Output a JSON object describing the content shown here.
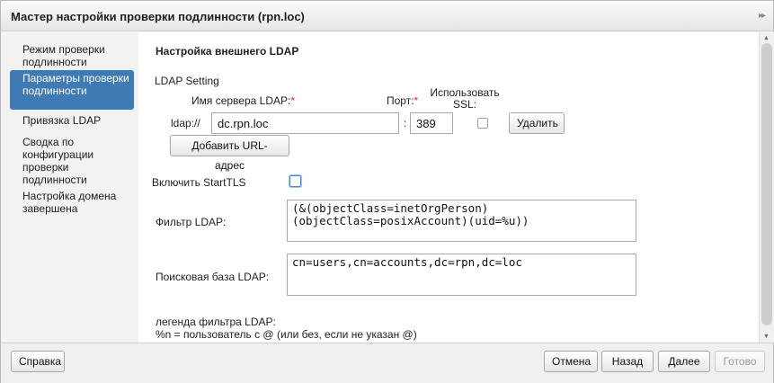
{
  "window": {
    "title": "Мастер настройки проверки подлинности (rpn.loc)",
    "collapse_glyph": "▸▸"
  },
  "sidebar": {
    "items": [
      {
        "label": "Режим проверки подлинности",
        "active": false
      },
      {
        "label": "Параметры проверки подлинности",
        "active": true
      },
      {
        "label": "Привязка LDAP",
        "active": false
      },
      {
        "label": "Сводка по конфигурации проверки подлинности",
        "active": false
      },
      {
        "label": "Настройка домена завершена",
        "active": false
      }
    ]
  },
  "main": {
    "section_title": "Настройка внешнего LDAP",
    "ldap_setting_label": "LDAP Setting",
    "server_name_label": "Имя сервера LDAP:",
    "port_label": "Порт:",
    "required_mark": "*",
    "use_ssl_label": "Использовать SSL:",
    "url_prefix": "ldap://",
    "server_value": "dc.rpn.loc",
    "colon": ":",
    "port_value": "389",
    "ssl_checked": false,
    "delete_button": "Удалить",
    "add_url_button": "Добавить URL-адрес",
    "starttls_label": "Включить StartTLS",
    "starttls_checked": false,
    "filter_label": "Фильтр LDAP:",
    "filter_value": "(&(objectClass=inetOrgPerson)\n(objectClass=posixAccount)(uid=%u))",
    "search_base_label": "Поисковая база LDAP:",
    "search_base_value": "cn=users,cn=accounts,dc=rpn,dc=loc",
    "legend_title": "легенда фильтра LDAP:",
    "legend_line1": "%n = пользователь с @ (или без, если не указан @)"
  },
  "footer": {
    "help_button": "Справка",
    "cancel_button": "Отмена",
    "back_button": "Назад",
    "next_button": "Далее",
    "finish_button": "Готово"
  },
  "colors": {
    "accent": "#3f7ab4",
    "required": "#d8282e"
  }
}
